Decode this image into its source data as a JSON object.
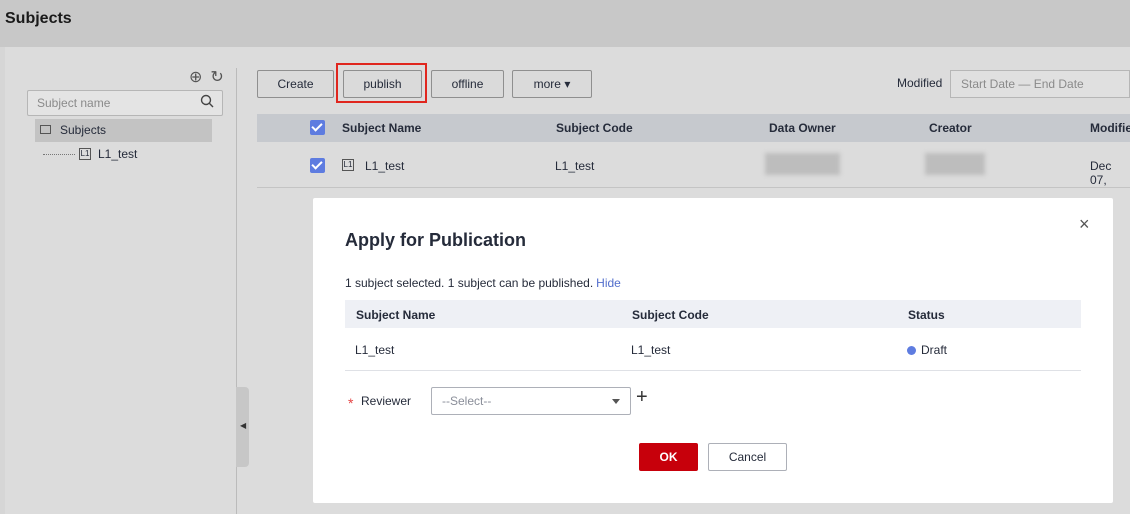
{
  "page": {
    "title": "Subjects"
  },
  "tree": {
    "search_placeholder": "Subject name",
    "root_label": "Subjects",
    "child_label": "L1_test",
    "child_badge": "L1"
  },
  "toolbar": {
    "create_label": "Create",
    "publish_label": "publish",
    "offline_label": "offline",
    "more_label": "more ▾",
    "modified_label": "Modified",
    "date_placeholder": "Start Date — End Date"
  },
  "table": {
    "columns": [
      "Subject Name",
      "Subject Code",
      "Data Owner",
      "Creator",
      "Modifie"
    ],
    "rows": [
      {
        "badge": "L1",
        "name": "L1_test",
        "code": "L1_test",
        "modified": "Dec 07,"
      }
    ]
  },
  "modal": {
    "title": "Apply for Publication",
    "selection_info": "1 subject selected. 1 subject can be published.",
    "hide_link": "Hide",
    "columns": [
      "Subject Name",
      "Subject Code",
      "Status"
    ],
    "rows": [
      {
        "name": "L1_test",
        "code": "L1_test",
        "status": "Draft"
      }
    ],
    "required_mark": "*",
    "reviewer_label": "Reviewer",
    "reviewer_value": "--Select--",
    "ok_label": "OK",
    "cancel_label": "Cancel",
    "close_glyph": "×",
    "plus_glyph": "+"
  },
  "colors": {
    "accent": "#5e7ce0",
    "primary_button": "#c7000b",
    "highlight_box": "#e0261e"
  }
}
